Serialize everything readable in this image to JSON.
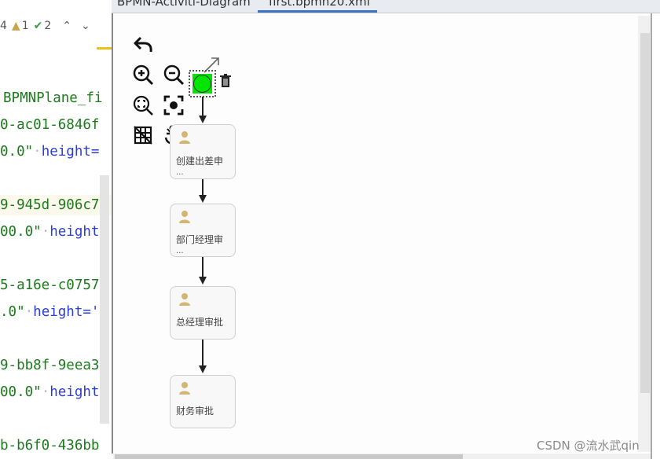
{
  "tabs": [
    {
      "label": "BPMN-Activiti-Diagram",
      "active": false
    },
    {
      "label": "first.bpmn20.xml",
      "active": true
    }
  ],
  "editor_toolbar": {
    "count_prefix": "4",
    "warning_count": "1",
    "check_count": "2",
    "up_icon": "chevron-up-icon",
    "down_icon": "chevron-down-icon"
  },
  "code_lines": [
    {
      "parts": [
        {
          "text": "BPMNPlane_fi",
          "color": "green"
        }
      ],
      "highlight": false
    },
    {
      "parts": [
        {
          "text": "0-ac01-6846f",
          "color": "green"
        }
      ],
      "highlight": false
    },
    {
      "parts": [
        {
          "text": "0.0\"",
          "color": "green"
        },
        {
          "text": "·",
          "color": "dot"
        },
        {
          "text": "height=",
          "color": "blue"
        }
      ],
      "highlight": false
    },
    {
      "parts": [
        {
          "text": "9-945d-906c7",
          "color": "green"
        }
      ],
      "highlight": true
    },
    {
      "parts": [
        {
          "text": "00.0\"",
          "color": "green"
        },
        {
          "text": "·",
          "color": "dot"
        },
        {
          "text": "height=",
          "color": "blue"
        }
      ],
      "highlight": false
    },
    {
      "parts": [
        {
          "text": "5-a16e-c0757",
          "color": "green"
        }
      ],
      "highlight": false
    },
    {
      "parts": [
        {
          "text": ".0\"",
          "color": "green"
        },
        {
          "text": "·",
          "color": "dot"
        },
        {
          "text": "height='",
          "color": "blue"
        }
      ],
      "highlight": false
    },
    {
      "parts": [
        {
          "text": "9-bb8f-9eea3",
          "color": "green"
        }
      ],
      "highlight": false
    },
    {
      "parts": [
        {
          "text": "00.0\"",
          "color": "green"
        },
        {
          "text": "·",
          "color": "dot"
        },
        {
          "text": "height=",
          "color": "blue"
        }
      ],
      "highlight": false
    },
    {
      "parts": [
        {
          "text": "b-b6f0-436bb",
          "color": "green"
        }
      ],
      "highlight": false
    }
  ],
  "diagram_tools": [
    {
      "name": "undo-icon"
    },
    {
      "name": "zoom-in-icon"
    },
    {
      "name": "zoom-out-icon"
    },
    {
      "name": "zoom-fit-icon"
    },
    {
      "name": "center-icon"
    },
    {
      "name": "grid-off-icon"
    },
    {
      "name": "anchor-off-icon"
    }
  ],
  "start_event": {
    "fill": "#00e600",
    "context_icons": [
      "connect-arrow-icon",
      "trash-icon"
    ]
  },
  "tasks": [
    {
      "label": "创建出差申",
      "truncated": true
    },
    {
      "label": "部门经理审",
      "truncated": true
    },
    {
      "label": "总经理审批",
      "truncated": false
    },
    {
      "label": "财务审批",
      "truncated": false
    }
  ],
  "task_ellipsis": "...",
  "colors": {
    "accent_tab": "#3b74c4",
    "person_icon": "#d4b672",
    "start_fill": "#00e600"
  },
  "watermark": "CSDN @流水武qin"
}
